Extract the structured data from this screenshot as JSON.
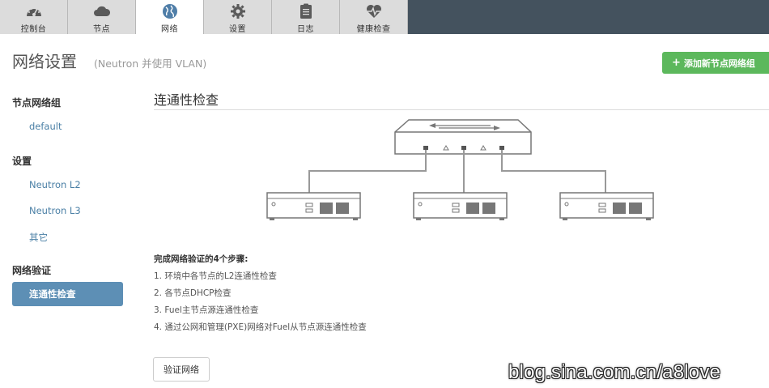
{
  "tabs": [
    {
      "label": "控制台",
      "icon": "dashboard-icon",
      "active": false
    },
    {
      "label": "节点",
      "icon": "cloud-icon",
      "active": false
    },
    {
      "label": "网络",
      "icon": "globe-icon",
      "active": true
    },
    {
      "label": "设置",
      "icon": "gear-icon",
      "active": false
    },
    {
      "label": "日志",
      "icon": "clipboard-icon",
      "active": false
    },
    {
      "label": "健康检查",
      "icon": "heart-pulse-icon",
      "active": false
    }
  ],
  "header": {
    "title": "网络设置",
    "subtitle": "(Neutron 并使用 VLAN)",
    "add_button": "添加新节点网络组",
    "add_icon": "+"
  },
  "sidebar": {
    "group_heading": "节点网络组",
    "group_items": [
      "default"
    ],
    "settings_heading": "设置",
    "settings_items": [
      "Neutron L2",
      "Neutron L3",
      "其它"
    ],
    "verify_heading": "网络验证",
    "verify_active": "连通性检查"
  },
  "main": {
    "section_title": "连通性检查",
    "steps_title": "完成网络验证的4个步骤:",
    "steps": [
      "1. 环境中各节点的L2连通性检查",
      "2. 各节点DHCP检查",
      "3. Fuel主节点源连通性检查",
      "4. 通过公网和管理(PXE)网络对Fuel从节点源连通性检查"
    ],
    "verify_button": "验证网络"
  },
  "watermark": "blog.sina.com.cn/a8love",
  "colors": {
    "topbar": "#44525e",
    "accent_green": "#5cb85c",
    "sidebar_active": "#5d8fb5",
    "link": "#4a7fa5"
  }
}
